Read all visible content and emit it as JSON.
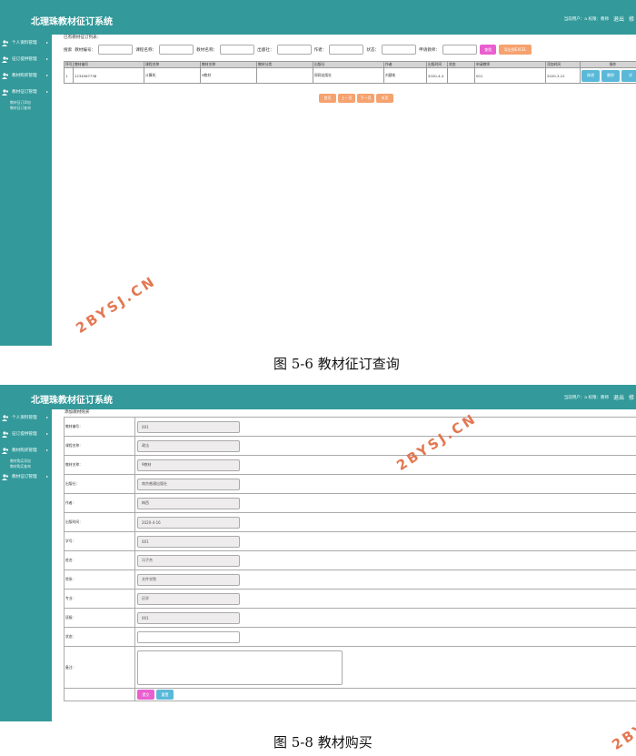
{
  "shot1": {
    "app_title": "北理珠教材征订系统",
    "user_info": "当前用户：a  权限：教师",
    "logout": "退出",
    "logout_extra": "修",
    "sidebar": [
      {
        "label": "个人资料管理",
        "subs": []
      },
      {
        "label": "征订提供管理",
        "subs": []
      },
      {
        "label": "教材购买管理",
        "subs": []
      },
      {
        "label": "教材征订管理",
        "subs": [
          "教材征订添加",
          "教材征订查询"
        ]
      }
    ],
    "list_caption": "已有教材征订列表：",
    "search": {
      "prefix": "搜索",
      "fields": [
        "教材编号：",
        "课程名称：",
        "教材名称：",
        "出版社：",
        "作者：",
        "状态：",
        "申请教师："
      ],
      "search_btn": "查找",
      "export_btn": "导出到EXCEL"
    },
    "table": {
      "headers": [
        "序号",
        "教材编号",
        "课程名称",
        "教材名称",
        "教材分类",
        "出版社",
        "作者",
        "出版时间",
        "状态",
        "申请教师",
        "添加时间",
        "操作"
      ],
      "rows": [
        [
          "1",
          "1234567738",
          "计算机",
          "9教材",
          "",
          "邢网出版社",
          "刘建彬",
          "2020-4-4",
          "",
          "001",
          "2020-3-21"
        ]
      ],
      "row_actions": [
        "修改",
        "删除",
        "详"
      ]
    },
    "pager": [
      "首页",
      "上一页",
      "下一页",
      "末页"
    ]
  },
  "caption1": "图 5-6 教材征订查询",
  "shot2": {
    "app_title": "北理珠教材征订系统",
    "user_info": "当前用户：a  权限：教师",
    "logout": "退出",
    "logout_extra": "修",
    "sidebar": [
      {
        "label": "个人资料管理",
        "subs": []
      },
      {
        "label": "征订提供管理",
        "subs": []
      },
      {
        "label": "教材购买管理",
        "subs": [
          "教材购买添加",
          "教材购买查询"
        ]
      },
      {
        "label": "教材征订管理",
        "subs": []
      }
    ],
    "add_caption": "添加教材购买",
    "form": [
      {
        "label": "教材编号：",
        "value": "001",
        "type": "readonly"
      },
      {
        "label": "课程名称：",
        "value": "政法",
        "type": "readonly"
      },
      {
        "label": "教材名称：",
        "value": "9教材",
        "type": "readonly"
      },
      {
        "label": "出版社：",
        "value": "南京普通出版社",
        "type": "readonly"
      },
      {
        "label": "作者：",
        "value": "梅西",
        "type": "readonly"
      },
      {
        "label": "出版时间：",
        "value": "2020-4-16",
        "type": "readonly"
      },
      {
        "label": "学号：",
        "value": "001",
        "type": "readonly"
      },
      {
        "label": "姓名：",
        "value": "冯子杰",
        "type": "readonly"
      },
      {
        "label": "院系：",
        "value": "文件学院",
        "type": "readonly"
      },
      {
        "label": "专业：",
        "value": "历学",
        "type": "readonly"
      },
      {
        "label": "班级：",
        "value": "001",
        "type": "readonly"
      },
      {
        "label": "状态：",
        "value": "",
        "type": "input"
      },
      {
        "label": "备注：",
        "value": "",
        "type": "textarea"
      }
    ],
    "submit_btn": "提交",
    "reset_btn": "重置"
  },
  "caption2": "图 5-8 教材购买",
  "watermark": "2BYSJ.CN",
  "colors": {
    "teal": "#33999a",
    "pink_button": "#ea5fd0",
    "orange_button": "#f5a26f",
    "blue_button": "#5ab9d9",
    "watermark": "#e06a40"
  },
  "icons": {
    "sidebar_group": "users-icon",
    "expand": "caret-right-icon"
  }
}
